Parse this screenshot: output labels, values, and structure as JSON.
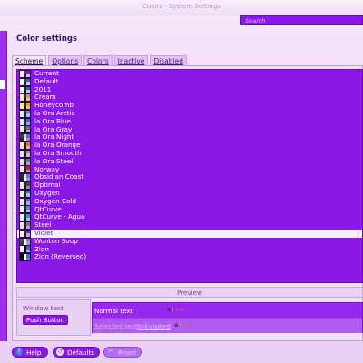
{
  "window": {
    "title": "Colors - System Settings"
  },
  "search": {
    "placeholder": "Search"
  },
  "page": {
    "heading": "Color settings"
  },
  "tabs": [
    {
      "label": "Scheme",
      "active": true
    },
    {
      "label": "Options",
      "active": false
    },
    {
      "label": "Colors",
      "active": false
    },
    {
      "label": "Inactive",
      "active": false
    },
    {
      "label": "Disabled",
      "active": false
    }
  ],
  "schemes": [
    {
      "name": "Current",
      "swatch": [
        "#ffffff",
        "#3b3b3b",
        "#8a16e8",
        "#f6e6fb",
        "#222222",
        "#d8b4f2"
      ]
    },
    {
      "name": "Default",
      "swatch": [
        "#ffffff",
        "#3b3b3b",
        "#2b6fd6",
        "#f0f0f0",
        "#222222",
        "#c0d6f0"
      ]
    },
    {
      "name": "2011",
      "swatch": [
        "#ffffff",
        "#333333",
        "#1f64c8",
        "#e6e6e6",
        "#111111",
        "#b8cce8"
      ]
    },
    {
      "name": "Cream",
      "swatch": [
        "#f5ead2",
        "#3a2a10",
        "#c6a05a",
        "#efe0c0",
        "#221100",
        "#e2c890"
      ]
    },
    {
      "name": "Honeycomb",
      "swatch": [
        "#f5e6a0",
        "#3a2a10",
        "#e2a81e",
        "#fbe8b0",
        "#221100",
        "#f0c050"
      ]
    },
    {
      "name": "la Ora Arctic",
      "swatch": [
        "#eef4f8",
        "#233040",
        "#5a8ab0",
        "#e0ebf2",
        "#102030",
        "#a8c6dc"
      ]
    },
    {
      "name": "la Ora Blue",
      "swatch": [
        "#e8eef8",
        "#202a40",
        "#3a6acc",
        "#dde6f4",
        "#101830",
        "#98b2e4"
      ]
    },
    {
      "name": "la Ora Gray",
      "swatch": [
        "#eeeeee",
        "#2a2a2a",
        "#707070",
        "#e4e4e4",
        "#111111",
        "#b0b0b0"
      ]
    },
    {
      "name": "la Ora Night",
      "swatch": [
        "#3a3a44",
        "#e0e0e0",
        "#5a6ad0",
        "#2a2a34",
        "#ffffff",
        "#8a90d8"
      ]
    },
    {
      "name": "la Ora Orange",
      "swatch": [
        "#f6ece2",
        "#3a2410",
        "#e07a20",
        "#f2e2d0",
        "#221000",
        "#f0b070"
      ]
    },
    {
      "name": "la Ora Smooth",
      "swatch": [
        "#f0eef2",
        "#2a2830",
        "#8a8ab0",
        "#e6e4ea",
        "#111018",
        "#c0c0d6"
      ]
    },
    {
      "name": "la Ora Steel",
      "swatch": [
        "#e8ecf0",
        "#222a32",
        "#6a7a8c",
        "#dde2e8",
        "#10161c",
        "#a8b4c2"
      ]
    },
    {
      "name": "Norway",
      "swatch": [
        "#f2f4f8",
        "#202838",
        "#c8202a",
        "#e6eaf2",
        "#101828",
        "#e08088"
      ]
    },
    {
      "name": "Obsidian Coast",
      "swatch": [
        "#2c2e34",
        "#e6e6e6",
        "#4a8ad0",
        "#202226",
        "#ffffff",
        "#7aa8dc"
      ]
    },
    {
      "name": "Optimal",
      "swatch": [
        "#f0f0f0",
        "#202020",
        "#4a4a4a",
        "#e4e4e4",
        "#101010",
        "#909090"
      ]
    },
    {
      "name": "Oxygen",
      "swatch": [
        "#ffffff",
        "#2e3436",
        "#3b7bc6",
        "#efefef",
        "#1a1a1a",
        "#a6c4e6"
      ]
    },
    {
      "name": "Oxygen Cold",
      "swatch": [
        "#f4f6fa",
        "#22283a",
        "#4a6ab8",
        "#e6eaf2",
        "#101828",
        "#a0b2dc"
      ]
    },
    {
      "name": "QtCurve",
      "swatch": [
        "#f6f6f6",
        "#222222",
        "#4a8ad6",
        "#ececec",
        "#111111",
        "#a8c8ee"
      ]
    },
    {
      "name": "QtCurve - Agua",
      "swatch": [
        "#f4f8fc",
        "#1a2a3a",
        "#3a9ad0",
        "#e8f0f8",
        "#0a1a2a",
        "#9acce8"
      ]
    },
    {
      "name": "Steel",
      "swatch": [
        "#e6e8ea",
        "#202428",
        "#6a7a88",
        "#dadcde",
        "#101418",
        "#aab4bc"
      ]
    },
    {
      "name": "Violet",
      "swatch": [
        "#ffffff",
        "#3a3a3a",
        "#8a16e8",
        "#f4e8fb",
        "#222222",
        "#c8a0f0"
      ]
    },
    {
      "name": "Wonton Soup",
      "swatch": [
        "#4a4e56",
        "#e8e8e8",
        "#7a8aa0",
        "#3c4048",
        "#ffffff",
        "#9aa6b8"
      ]
    },
    {
      "name": "Zion",
      "swatch": [
        "#ffffff",
        "#000000",
        "#3a6ac8",
        "#f4f4f4",
        "#000000",
        "#a0b8e8"
      ]
    },
    {
      "name": "Zion (Reversed)",
      "swatch": [
        "#000000",
        "#ffffff",
        "#3a6ac8",
        "#101010",
        "#ffffff",
        "#6080c8"
      ]
    }
  ],
  "selected_scheme": "Violet",
  "preview": {
    "title": "Preview",
    "window_text": "Window text",
    "push_button": "Push Button",
    "normal_text": "Normal text",
    "selected_text": "Selected text",
    "link": "link",
    "visited": "visited",
    "glyphs_normal": [
      "a",
      "i",
      "=",
      "a"
    ],
    "glyphs_selected": [
      "a",
      "i",
      "=",
      "a"
    ],
    "glyph_colors": [
      "#3a3a3a",
      "#c07aa0",
      "#e07040",
      "#b050d0"
    ]
  },
  "buttons": {
    "help": "Help",
    "defaults": "Defaults",
    "reset": "Reset"
  },
  "colors": {
    "accent": "#8a16e8",
    "selection": "#f4f0f8",
    "background": "#efd9f7"
  }
}
